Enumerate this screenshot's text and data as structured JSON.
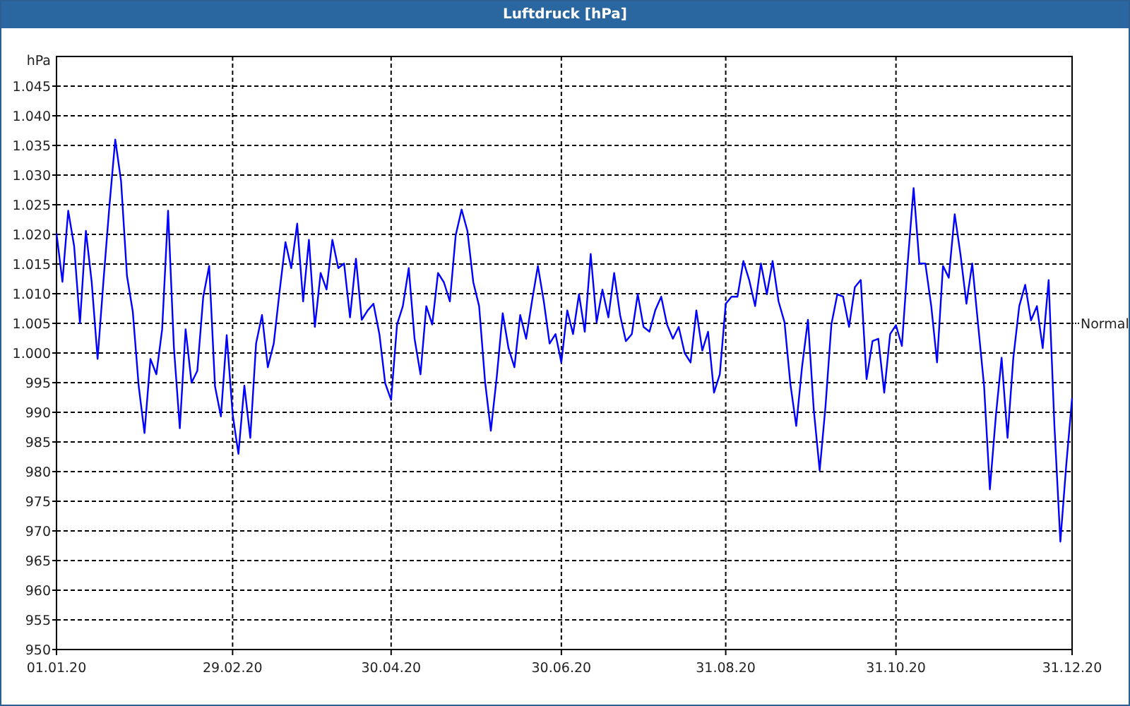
{
  "window": {
    "title": "Luftdruck [hPa]"
  },
  "chart": {
    "chart_data": {
      "type": "line",
      "ylabel": "hPa",
      "categories": [
        "01.01.20",
        null,
        null,
        null,
        null,
        null,
        null,
        null,
        null,
        null,
        null,
        null,
        null,
        null,
        null,
        null,
        null,
        null,
        null,
        null,
        null,
        null,
        null,
        null,
        null,
        null,
        null,
        null,
        null,
        null,
        "29.02.20",
        null,
        null,
        null,
        null,
        null,
        null,
        null,
        null,
        null,
        null,
        null,
        null,
        null,
        null,
        null,
        null,
        null,
        null,
        null,
        null,
        null,
        null,
        null,
        null,
        null,
        null,
        "30.04.20",
        null,
        null,
        null,
        null,
        null,
        null,
        null,
        null,
        null,
        null,
        null,
        null,
        null,
        null,
        null,
        null,
        null,
        null,
        null,
        null,
        null,
        null,
        null,
        null,
        null,
        null,
        null,
        null,
        "30.06.20",
        null,
        null,
        null,
        null,
        null,
        null,
        null,
        null,
        null,
        null,
        null,
        null,
        null,
        null,
        null,
        null,
        null,
        null,
        null,
        null,
        null,
        null,
        null,
        null,
        null,
        null,
        null,
        "31.08.20",
        null,
        null,
        null,
        null,
        null,
        null,
        null,
        null,
        null,
        null,
        null,
        null,
        null,
        null,
        null,
        null,
        null,
        null,
        null,
        null,
        null,
        null,
        null,
        null,
        null,
        null,
        null,
        null,
        "31.10.20",
        null,
        null,
        null,
        null,
        null,
        null,
        null,
        null,
        null,
        null,
        null,
        null,
        null,
        null,
        null,
        null,
        null,
        null,
        null,
        null,
        null,
        null,
        null,
        null,
        null,
        null,
        null,
        null,
        null,
        "31.12.20"
      ],
      "series": [
        {
          "color": "#0000ff",
          "values": [
            1020.2,
            1012,
            1024,
            1018,
            1005,
            1020.6,
            1012,
            999,
            1012,
            1024.6,
            1036,
            1029,
            1013,
            1007,
            994.4,
            986.5,
            999,
            996.4,
            1004,
            1024,
            1001,
            987.3,
            1004,
            995,
            997,
            1009.5,
            1014.7,
            994.4,
            989.3,
            1003,
            989.7,
            983,
            994.5,
            985.7,
            1001.6,
            1006.4,
            997.6,
            1001.6,
            1010.3,
            1018.7,
            1014.3,
            1021.8,
            1008.7,
            1019.1,
            1004.4,
            1013.5,
            1010.7,
            1019.1,
            1014.3,
            1015.1,
            1006,
            1015.9,
            1005.6,
            1007.2,
            1008.3,
            1003.2,
            994.9,
            992.1,
            1004.8,
            1007.9,
            1014.3,
            1002.4,
            996.4,
            1007.9,
            1004.8,
            1013.5,
            1011.9,
            1008.7,
            1019.8,
            1024.2,
            1020.6,
            1011.9,
            1007.9,
            995.2,
            986.9,
            996,
            1006.7,
            1000.8,
            997.6,
            1006.4,
            1002.4,
            1008.7,
            1014.7,
            1008.7,
            1001.6,
            1003.2,
            998.4,
            1007.2,
            1003.2,
            1009.9,
            1003.6,
            1016.7,
            1005.2,
            1010.7,
            1006,
            1013.5,
            1006.4,
            1002,
            1003.2,
            1009.9,
            1004.4,
            1003.6,
            1007.2,
            1009.5,
            1004.8,
            1002.4,
            1004.4,
            1000,
            998.4,
            1007.2,
            1000.4,
            1003.6,
            993.3,
            996.4,
            1008.3,
            1009.5,
            1009.5,
            1015.5,
            1012.3,
            1007.9,
            1015.1,
            1009.9,
            1015.5,
            1008.7,
            1005.2,
            994.9,
            987.7,
            997.6,
            1005.6,
            990.5,
            980.2,
            990.9,
            1004.8,
            1009.9,
            1009.5,
            1004.4,
            1011.1,
            1012.3,
            995.6,
            1002,
            1002.4,
            993.3,
            1003.2,
            1004.7,
            1001.2,
            1015.1,
            1027.8,
            1015.1,
            1015.1,
            1007.9,
            998.4,
            1014.7,
            1012.7,
            1023.4,
            1016.6,
            1008.3,
            1015.1,
            1004.7,
            994.4,
            977,
            989.3,
            999.2,
            985.7,
            999.2,
            1007.9,
            1011.5,
            1005.5,
            1007.9,
            1000.8,
            1012.3,
            987.7,
            968.2,
            980.9,
            992.4
          ]
        }
      ],
      "ylim": [
        950,
        1050
      ],
      "yticks": [
        {
          "value": 950,
          "label": "950"
        },
        {
          "value": 955,
          "label": "955"
        },
        {
          "value": 960,
          "label": "960"
        },
        {
          "value": 965,
          "label": "965"
        },
        {
          "value": 970,
          "label": "970"
        },
        {
          "value": 975,
          "label": "975"
        },
        {
          "value": 980,
          "label": "980"
        },
        {
          "value": 985,
          "label": "985"
        },
        {
          "value": 990,
          "label": "990"
        },
        {
          "value": 995,
          "label": "995"
        },
        {
          "value": 1000,
          "label": "1.000"
        },
        {
          "value": 1005,
          "label": "1.005"
        },
        {
          "value": 1010,
          "label": "1.010"
        },
        {
          "value": 1015,
          "label": "1.015"
        },
        {
          "value": 1020,
          "label": "1.020"
        },
        {
          "value": 1025,
          "label": "1.025"
        },
        {
          "value": 1030,
          "label": "1.030"
        },
        {
          "value": 1035,
          "label": "1.035"
        },
        {
          "value": 1040,
          "label": "1.040"
        },
        {
          "value": 1045,
          "label": "1.045"
        }
      ],
      "grid": true,
      "annotations": [
        "Normal"
      ]
    }
  }
}
